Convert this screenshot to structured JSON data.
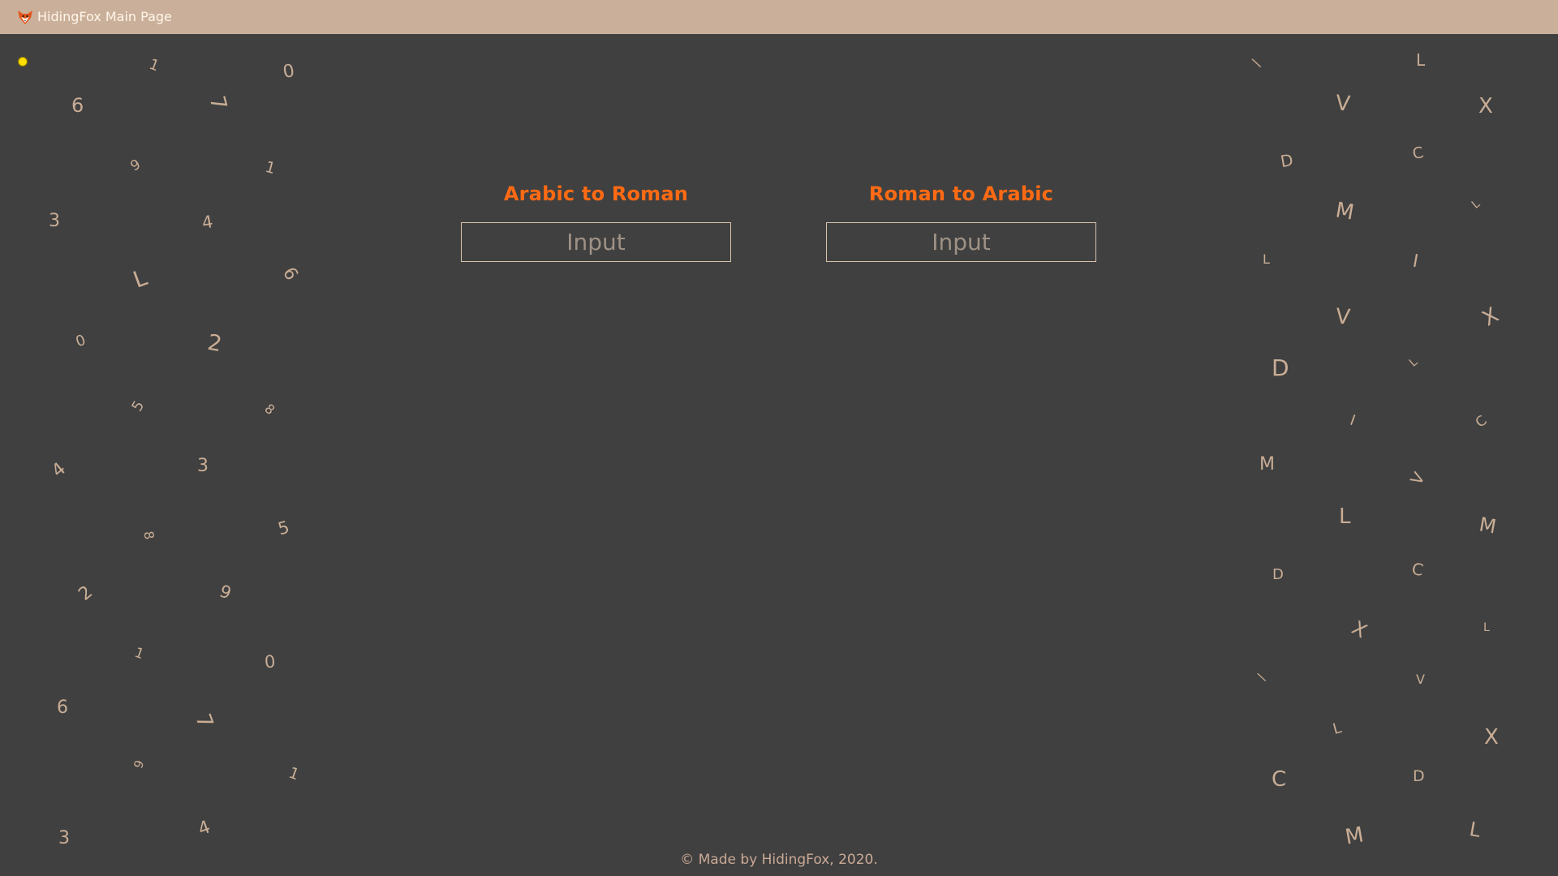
{
  "app": {
    "title": "HidingFox Main Page",
    "logo_icon": "fox-icon",
    "accent_color": "#ff6a13",
    "topbar_color": "#cab09a",
    "background_color": "#404040"
  },
  "converters": [
    {
      "title": "Arabic to Roman",
      "placeholder": "Input"
    },
    {
      "title": "Roman to Arabic",
      "placeholder": "Input"
    }
  ],
  "decor": {
    "left_digits": [
      "1",
      "0",
      "6",
      "7",
      "9",
      "1",
      "3",
      "4",
      "L",
      "6",
      "0",
      "2",
      "5",
      "8",
      "4",
      "3",
      "8",
      "5",
      "2",
      "9",
      "1",
      "0",
      "6",
      "7",
      "9",
      "1",
      "3",
      "4"
    ],
    "right_numerals": [
      "\\",
      "L",
      "V",
      "X",
      "D",
      "C",
      "M",
      "L",
      "L",
      "I",
      "V",
      "X",
      "D",
      "L",
      "I",
      "C",
      "M",
      "V",
      "L",
      "M",
      "D",
      "C",
      "X",
      "L",
      "\\",
      "V",
      "L",
      "X",
      "C",
      "D",
      "M",
      "L"
    ]
  },
  "footer": {
    "text": "© Made by HidingFox, 2020."
  }
}
